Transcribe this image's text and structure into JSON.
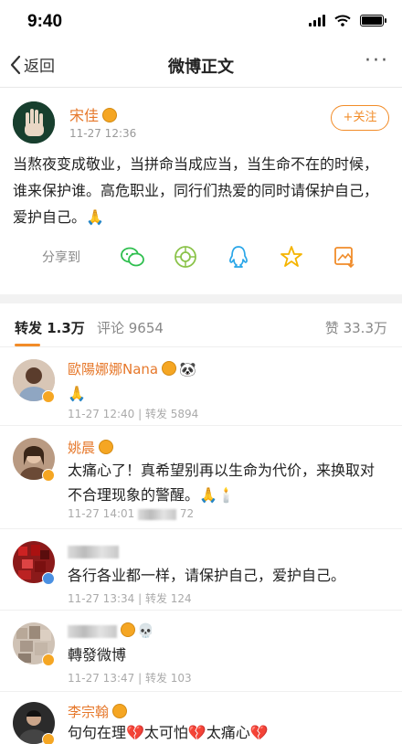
{
  "status_bar": {
    "time": "9:40"
  },
  "nav": {
    "back_label": "返回",
    "title": "微博正文",
    "more": "···"
  },
  "post": {
    "author": "宋佳",
    "time": "11-27 12:36",
    "follow_label": "+关注",
    "text": "当熬夜变成敬业，当拼命当成应当，当生命不在的时候，谁来保护谁。高危职业，同行们热爱的同时请保护自己，爱护自己。🙏",
    "share_label": "分享到",
    "share_icons": [
      "wechat-icon",
      "moments-icon",
      "qq-icon",
      "qzone-star-icon",
      "save-image-icon"
    ]
  },
  "tabs": {
    "repost": "转发 1.3万",
    "comment": "评论 9654",
    "like": "赞 33.3万"
  },
  "comments": [
    {
      "name": "歐陽娜娜Nana",
      "text": "🙏",
      "meta": "11-27 12:40 | 转发 5894"
    },
    {
      "name": "姚晨",
      "text": "太痛心了！真希望别再以生命为代价，来换取对不合理现象的警醒。🙏🕯️",
      "meta_time": "11-27 14:01",
      "meta_tail": "72"
    },
    {
      "name": "",
      "text": "各行各业都一样，请保护自己，爱护自己。",
      "meta": "11-27 13:34 | 转发 124"
    },
    {
      "name": "",
      "text": "轉發微博",
      "meta": "11-27 13:47 | 转发 103"
    },
    {
      "name": "李宗翰",
      "text": "句句在理💔太可怕💔太痛心💔"
    }
  ],
  "colors": {
    "accent": "#f28c28",
    "name": "#e6782b",
    "badge": "#f5a623"
  }
}
